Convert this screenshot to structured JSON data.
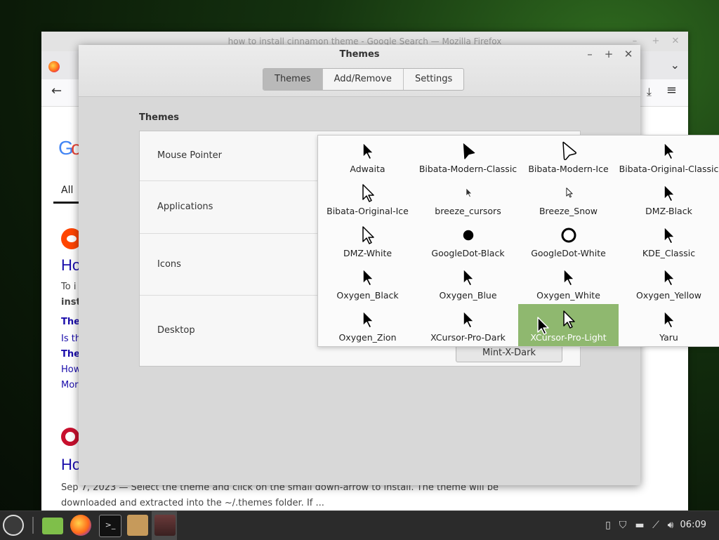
{
  "firefox": {
    "window_title": "how to install cinnamon theme - Google Search — Mozilla Firefox",
    "tab_all": "All",
    "result1_title": "Ho",
    "result1_lines": [
      "To i",
      "inst"
    ],
    "result1_links": [
      "The",
      "Is th",
      "The",
      "How",
      "Mor"
    ],
    "result2_title": "Ho",
    "result2_snippet_1": "Sep 7, 2023 — Select the theme and click on the small down-arrow to install. The theme will be",
    "result2_snippet_2": "downloaded and extracted into the ~/.themes folder. If ...",
    "google_letters": [
      "G",
      "o"
    ]
  },
  "themes_window": {
    "title": "Themes",
    "tabs": [
      "Themes",
      "Add/Remove",
      "Settings"
    ],
    "active_tab": "Themes",
    "section": "Themes",
    "rows": [
      "Mouse Pointer",
      "Applications",
      "Icons",
      "Desktop"
    ],
    "desktop_value": "Mint-X-Dark",
    "minimize": "–",
    "maximize": "+",
    "close": "✕"
  },
  "cursor_popup": {
    "selected": "XCursor-Pro-Light",
    "items": [
      {
        "name": "Adwaita",
        "icon": "arrow-black"
      },
      {
        "name": "Bibata-Modern-Classic",
        "icon": "arrow-black-round"
      },
      {
        "name": "Bibata-Modern-Ice",
        "icon": "arrow-white-round"
      },
      {
        "name": "Bibata-Original-Classic",
        "icon": "arrow-black"
      },
      {
        "name": "Bibata-Original-Ice",
        "icon": "arrow-white"
      },
      {
        "name": "breeze_cursors",
        "icon": "arrow-dark-small"
      },
      {
        "name": "Breeze_Snow",
        "icon": "arrow-white-small"
      },
      {
        "name": "DMZ-Black",
        "icon": "arrow-black"
      },
      {
        "name": "DMZ-White",
        "icon": "arrow-white"
      },
      {
        "name": "GoogleDot-Black",
        "icon": "dot-black"
      },
      {
        "name": "GoogleDot-White",
        "icon": "dot-white"
      },
      {
        "name": "KDE_Classic",
        "icon": "arrow-black"
      },
      {
        "name": "Oxygen_Black",
        "icon": "arrow-black"
      },
      {
        "name": "Oxygen_Blue",
        "icon": "arrow-black"
      },
      {
        "name": "Oxygen_White",
        "icon": "arrow-black"
      },
      {
        "name": "Oxygen_Yellow",
        "icon": "arrow-black"
      },
      {
        "name": "Oxygen_Zion",
        "icon": "arrow-black"
      },
      {
        "name": "XCursor-Pro-Dark",
        "icon": "arrow-black"
      },
      {
        "name": "XCursor-Pro-Light",
        "icon": "arrow-white"
      },
      {
        "name": "Yaru",
        "icon": "arrow-black"
      }
    ]
  },
  "taskbar": {
    "clock": "06:09",
    "launchers": [
      "mint-menu-icon",
      "files-icon",
      "firefox-icon",
      "terminal-icon",
      "archive-icon",
      "themes-app-icon"
    ]
  },
  "colors": {
    "selection": "#8fb86f",
    "link": "#1a0dab",
    "taskbar": "#2b2b2b"
  }
}
